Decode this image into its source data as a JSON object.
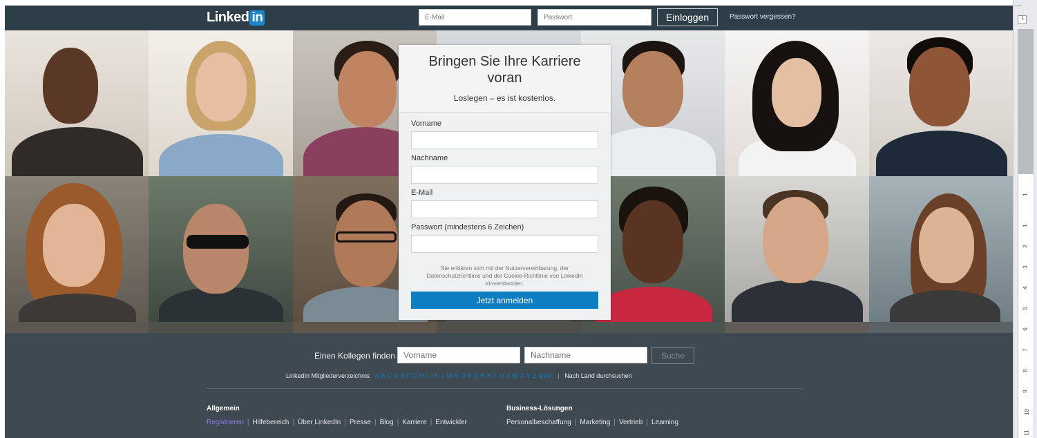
{
  "header": {
    "logo_text": "Linked",
    "logo_badge": "in",
    "email_placeholder": "E-Mail",
    "password_placeholder": "Passwort",
    "login_label": "Einloggen",
    "forgot_label": "Passwort vergessen?"
  },
  "signup_card": {
    "title": "Bringen Sie Ihre Karriere voran",
    "subtitle": "Loslegen – es ist kostenlos.",
    "first_name_label": "Vorname",
    "last_name_label": "Nachname",
    "email_label": "E-Mail",
    "password_label": "Passwort (mindestens 6 Zeichen)",
    "legal_text": "Sie erklären sich mit der Nutzervereinbarung, der Datenschutzrichtlinie und der Cookie-Richtlinie von LinkedIn einverstanden.",
    "submit_label": "Jetzt anmelden"
  },
  "footer": {
    "find_colleague_label": "Einen Kollegen finden",
    "first_name_placeholder": "Vorname",
    "last_name_placeholder": "Nachname",
    "search_label": "Suche",
    "directory_label": "LinkedIn Mitgliederverzeichnis:",
    "letters": [
      "A",
      "B",
      "C",
      "D",
      "E",
      "F",
      "G",
      "H",
      "I",
      "J",
      "K",
      "L",
      "M",
      "N",
      "O",
      "P",
      "Q",
      "R",
      "S",
      "T",
      "U",
      "V",
      "W",
      "X",
      "Y",
      "Z",
      "Mehr"
    ],
    "browse_country_label": "Nach Land durchsuchen",
    "general_title": "Allgemein",
    "general_links": [
      "Registrieren",
      "Hilfebereich",
      "Über LinkedIn",
      "Presse",
      "Blog",
      "Karriere",
      "Entwickler"
    ],
    "business_title": "Business-Lösungen",
    "business_links": [
      "Personalbeschaffung",
      "Marketing",
      "Vertrieb",
      "Learning"
    ]
  },
  "colors": {
    "header_bg": "#2e3e48",
    "footer_bg": "#3f4952",
    "brand_blue": "#0e7ec2",
    "visited_link": "#8c7ee8"
  },
  "ruler_ticks": [
    "1",
    "1",
    "2",
    "3",
    "4",
    "5",
    "6",
    "7",
    "8",
    "9",
    "10",
    "11"
  ]
}
